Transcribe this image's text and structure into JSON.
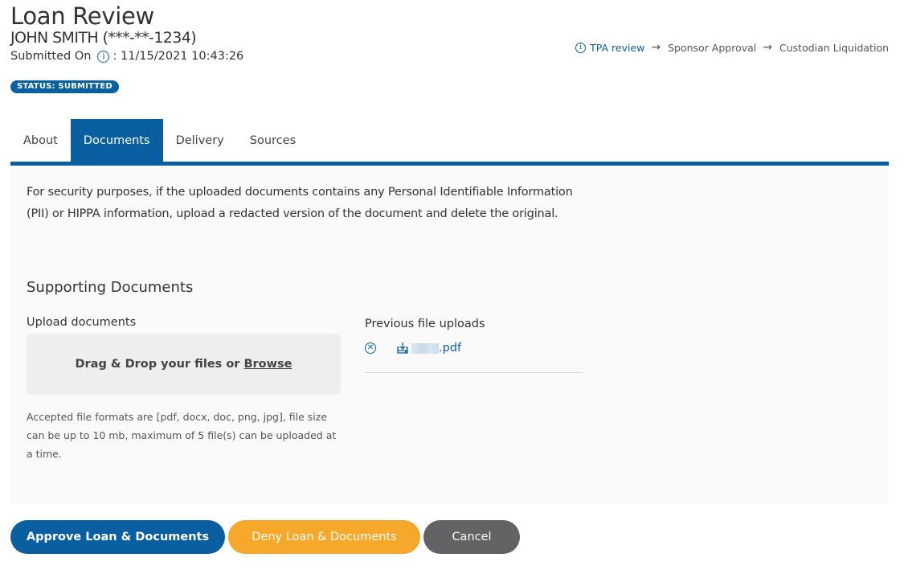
{
  "header": {
    "title": "Loan Review",
    "subtitle": "JOHN SMITH (***-**-1234)",
    "submitted_label": "Submitted On",
    "submitted_value": ": 11/15/2021 10:43:26",
    "status": "STATUS: SUBMITTED"
  },
  "workflow": {
    "steps": [
      {
        "label": "TPA review",
        "active": true
      },
      {
        "label": "Sponsor Approval",
        "active": false
      },
      {
        "label": "Custodian Liquidation",
        "active": false
      }
    ],
    "arrow": "→"
  },
  "tabs": [
    {
      "label": "About",
      "active": false
    },
    {
      "label": "Documents",
      "active": true
    },
    {
      "label": "Delivery",
      "active": false
    },
    {
      "label": "Sources",
      "active": false
    }
  ],
  "documents": {
    "notice": "For security purposes, if the uploaded documents contains any Personal Identifiable Information (PII) or HIPPA information, upload a redacted version of the document and delete the original.",
    "section_title": "Supporting Documents",
    "upload_label": "Upload documents",
    "dropzone_text": "Drag & Drop your files or",
    "browse_label": "Browse",
    "formats_note": "Accepted file formats are [pdf, docx, doc, png, jpg], file size can be up to 10 mb, maximum of 5 file(s) can be uploaded at a time.",
    "previous_label": "Previous file uploads",
    "files": [
      {
        "name_suffix": ".pdf"
      }
    ]
  },
  "actions": {
    "approve": "Approve Loan & Documents",
    "deny": "Deny Loan & Documents",
    "cancel": "Cancel"
  },
  "colors": {
    "primary": "#0a5fa0",
    "deny": "#f5a82a",
    "cancel": "#636366",
    "panel_bg": "#fafafa"
  }
}
